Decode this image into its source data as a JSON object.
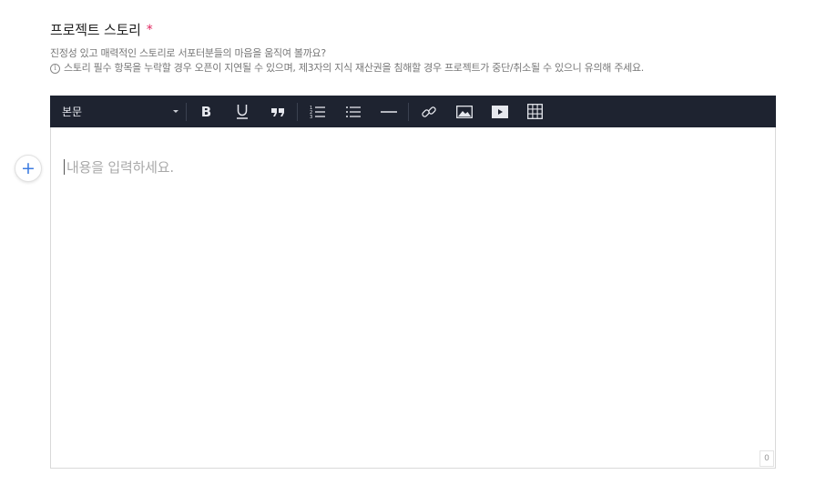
{
  "field": {
    "title": "프로젝트 스토리",
    "required_mark": "*",
    "description_line1": "진정성 있고 매력적인 스토리로 서포터분들의 마음을 움직여 볼까요?",
    "info_symbol": "i",
    "description_line2": "스토리 필수 항목을 누락할 경우 오픈이 지연될 수 있으며, 제3자의 지식 재산권을 침해할 경우 프로젝트가 중단/취소될 수 있으니 유의해 주세요."
  },
  "toolbar": {
    "format_value": "본문",
    "buttons": [
      {
        "name": "bold-button",
        "icon": "bold-icon",
        "label": "B"
      },
      {
        "name": "underline-button",
        "icon": "underline-icon"
      },
      {
        "name": "quote-button",
        "icon": "quote-icon"
      },
      {
        "name": "ordered-list-button",
        "icon": "ordered-list-icon"
      },
      {
        "name": "bullet-list-button",
        "icon": "bullet-list-icon"
      },
      {
        "name": "horizontal-rule-button",
        "icon": "horizontal-rule-icon"
      },
      {
        "name": "link-button",
        "icon": "link-icon"
      },
      {
        "name": "image-button",
        "icon": "image-icon"
      },
      {
        "name": "video-button",
        "icon": "video-icon"
      },
      {
        "name": "table-button",
        "icon": "table-icon"
      }
    ]
  },
  "editor": {
    "placeholder": "내용을 입력하세요.",
    "add_block_symbol": "+",
    "char_count": "0"
  },
  "colors": {
    "toolbar_bg": "#1e2330",
    "required": "#e0245e",
    "accent": "#3c7be0"
  }
}
